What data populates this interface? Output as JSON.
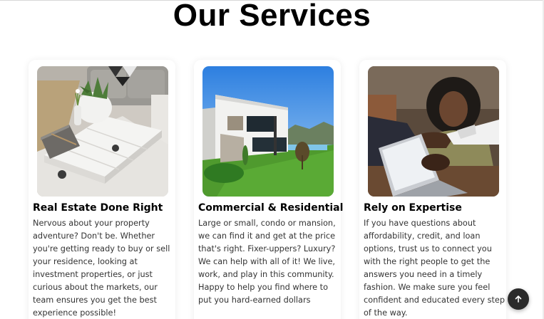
{
  "page": {
    "title": "Our Services"
  },
  "services": [
    {
      "image_alt": "living room coffee table with plants",
      "heading": "Real Estate Done Right",
      "description": "Nervous about your property adventure? Don't be. Whether you're getting ready to buy or sell your residence, looking at investment properties, or just curious about the markets, our team ensures you get the best experience possible!"
    },
    {
      "image_alt": "modern white house with lawn",
      "heading": "Commercial & Residential",
      "description": "Large or small, condo or mansion, we can find it and get at the price that's right. Fixer-uppers? Luxury? We can help with all of it! We live, work, and play in this community. Happy to help you find where to put you hard-earned dollars"
    },
    {
      "image_alt": "people shaking hands over a laptop",
      "heading": "Rely on Expertise",
      "description": "If you have questions about affordability, credit, and loan options, trust us to connect you with the right people to get the answers you need in a timely fashion. We make sure you feel confident and educated every step of the way."
    }
  ],
  "back_to_top": {
    "icon": "arrow-up-icon"
  }
}
